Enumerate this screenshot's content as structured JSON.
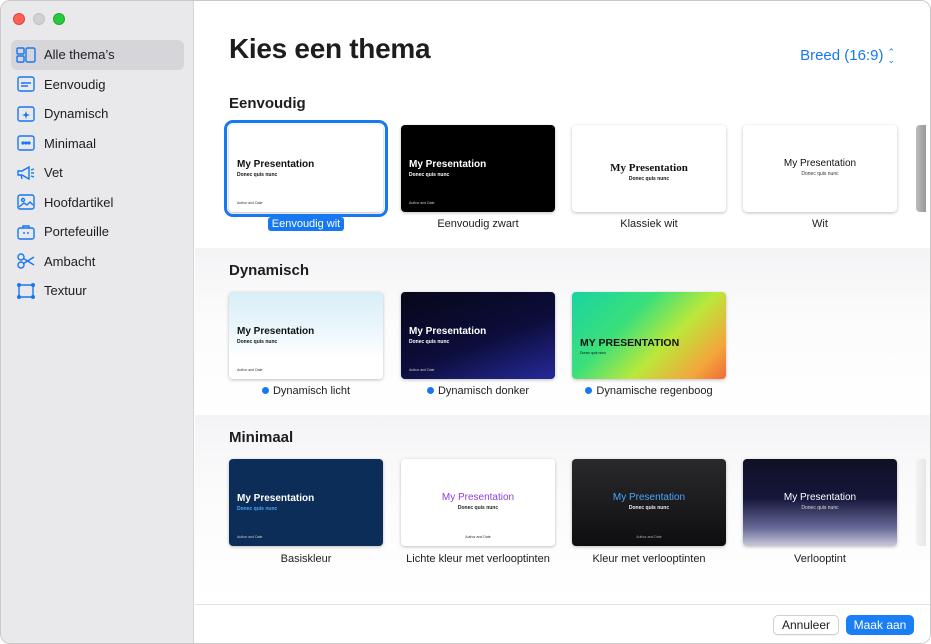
{
  "window": {
    "controls": [
      "close",
      "minimize",
      "zoom"
    ]
  },
  "sidebar": {
    "items": [
      {
        "label": "Alle thema’s",
        "icon": "all-themes-icon",
        "active": true
      },
      {
        "label": "Eenvoudig",
        "icon": "simple-slide-icon"
      },
      {
        "label": "Dynamisch",
        "icon": "dynamic-sparkle-icon"
      },
      {
        "label": "Minimaal",
        "icon": "minimal-dots-icon"
      },
      {
        "label": "Vet",
        "icon": "megaphone-icon"
      },
      {
        "label": "Hoofdartikel",
        "icon": "picture-icon"
      },
      {
        "label": "Portefeuille",
        "icon": "briefcase-icon"
      },
      {
        "label": "Ambacht",
        "icon": "scissors-icon"
      },
      {
        "label": "Textuur",
        "icon": "texture-frame-icon"
      }
    ]
  },
  "header": {
    "title": "Kies een thema",
    "aspect": "Breed (16:9)"
  },
  "slide_text": {
    "title": "My Presentation",
    "title_caps": "MY PRESENTATION",
    "subtitle": "Donec quis nunc",
    "footer": "Author and Date"
  },
  "sections": [
    {
      "title": "Eenvoudig",
      "themes": [
        "Eenvoudig wit",
        "Eenvoudig zwart",
        "Klassiek wit",
        "Wit"
      ],
      "selected": "Eenvoudig wit"
    },
    {
      "title": "Dynamisch",
      "themes": [
        "Dynamisch licht",
        "Dynamisch donker",
        "Dynamische regenboog"
      ]
    },
    {
      "title": "Minimaal",
      "themes": [
        "Basiskleur",
        "Lichte kleur met verlooptinten",
        "Kleur met verlooptinten",
        "Verlooptint"
      ]
    }
  ],
  "footer": {
    "cancel": "Annuleer",
    "create": "Maak aan"
  },
  "colors": {
    "accent": "#1877f2",
    "sidebar_bg": "#e9e9ec"
  }
}
